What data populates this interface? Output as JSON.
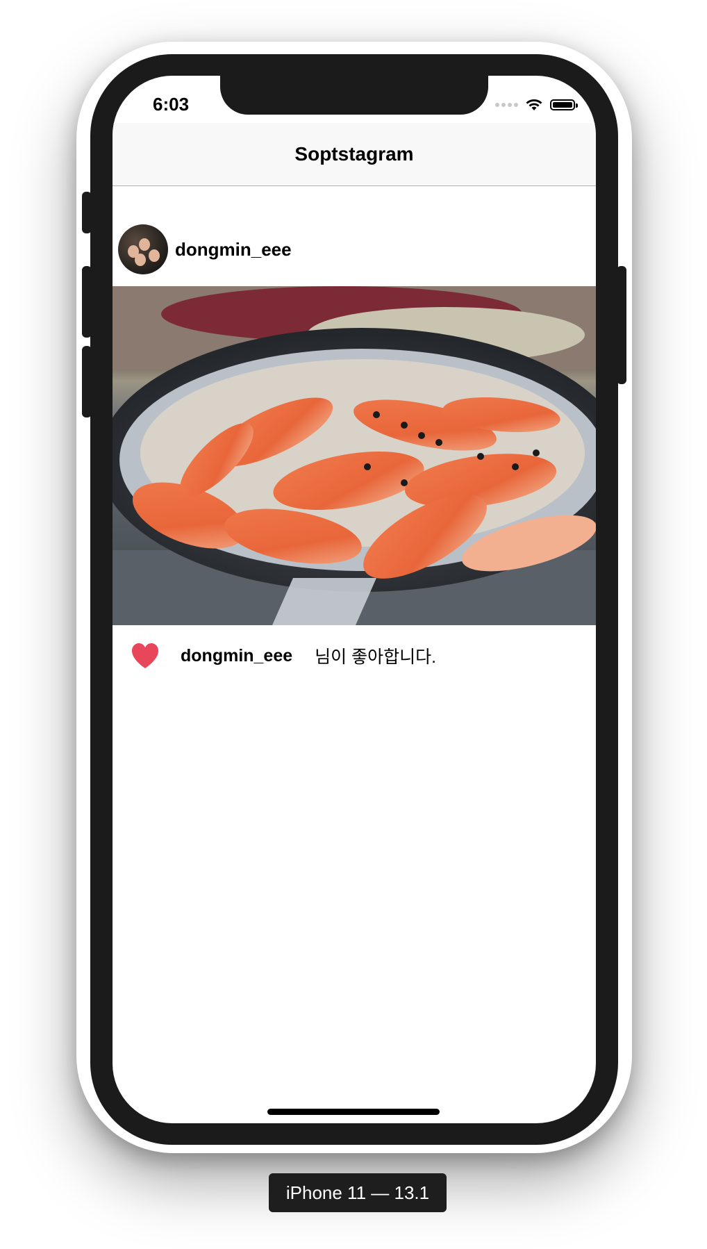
{
  "status_bar": {
    "time": "6:03"
  },
  "nav": {
    "title": "Soptstagram"
  },
  "post": {
    "username": "dongmin_eee",
    "like_username": "dongmin_eee",
    "like_text": "님이 좋아합니다."
  },
  "device_label": "iPhone 11 — 13.1",
  "colors": {
    "heart": "#e8465a",
    "nav_background": "#f8f8f8",
    "device_frame": "#1b1b1b"
  }
}
